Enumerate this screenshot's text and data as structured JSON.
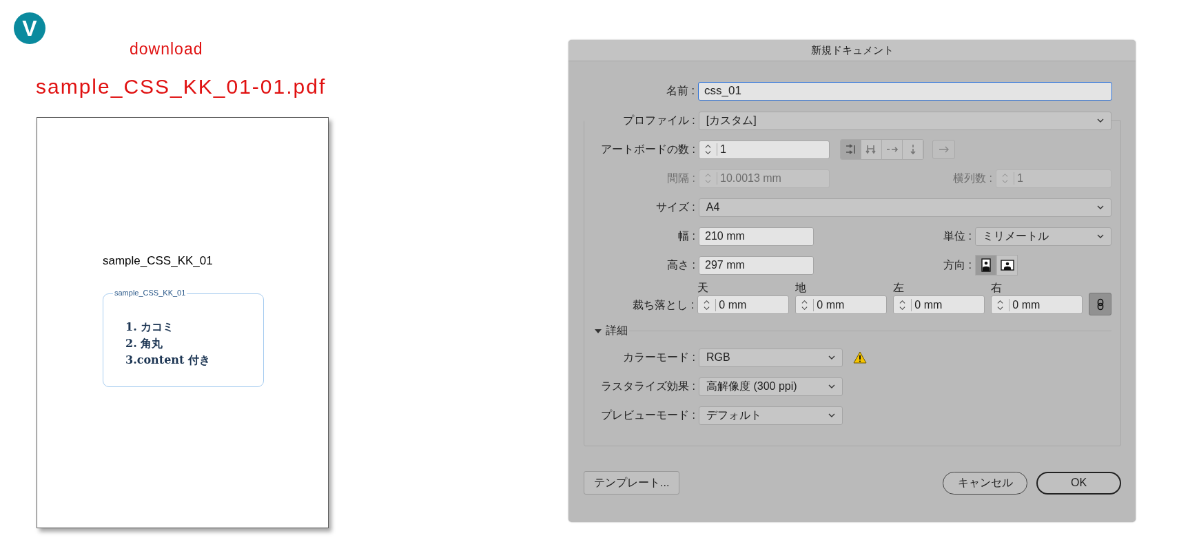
{
  "logo": {
    "letter": "V"
  },
  "download_label": "download",
  "file_link": "sample_CSS_KK_01-01.pdf",
  "page_preview": {
    "heading": "sample_CSS_KK_01",
    "box": {
      "legend": "sample_CSS_KK_01",
      "items": [
        "1. カコミ",
        "2. 角丸",
        "3.content 付き"
      ]
    }
  },
  "dialog": {
    "title": "新規ドキュメント",
    "name": {
      "label": "名前 :",
      "value": "css_01"
    },
    "profile": {
      "label": "プロファイル :",
      "value": "[カスタム]"
    },
    "artboards": {
      "label": "アートボードの数 :",
      "value": "1"
    },
    "layout_buttons": [
      {
        "kind": "grid-row",
        "selected": true
      },
      {
        "kind": "grid-col",
        "selected": false
      },
      {
        "kind": "row",
        "selected": false
      },
      {
        "kind": "col",
        "selected": false
      }
    ],
    "spacing": {
      "label": "間隔 :",
      "value": "10.0013 mm",
      "disabled": true
    },
    "columns": {
      "label": "横列数 :",
      "value": "1",
      "disabled": true
    },
    "size": {
      "label": "サイズ :",
      "value": "A4"
    },
    "width": {
      "label": "幅 :",
      "value": "210 mm"
    },
    "units": {
      "label": "単位 :",
      "value": "ミリメートル"
    },
    "height": {
      "label": "高さ :",
      "value": "297 mm"
    },
    "orientation": {
      "label": "方向 :",
      "options": [
        {
          "kind": "portrait",
          "selected": true
        },
        {
          "kind": "landscape",
          "selected": false
        }
      ]
    },
    "bleed": {
      "label": "裁ち落とし :",
      "linked": true,
      "fields": [
        {
          "label": "天",
          "value": "0 mm"
        },
        {
          "label": "地",
          "value": "0 mm"
        },
        {
          "label": "左",
          "value": "0 mm"
        },
        {
          "label": "右",
          "value": "0 mm"
        }
      ]
    },
    "advanced": {
      "label": "詳細",
      "expanded": true
    },
    "color_mode": {
      "label": "カラーモード :",
      "value": "RGB",
      "warning": true
    },
    "raster": {
      "label": "ラスタライズ効果 :",
      "value": "高解像度 (300 ppi)"
    },
    "preview_mode": {
      "label": "プレビューモード :",
      "value": "デフォルト"
    },
    "buttons": {
      "template": "テンプレート...",
      "cancel": "キャンセル",
      "ok": "OK"
    }
  }
}
